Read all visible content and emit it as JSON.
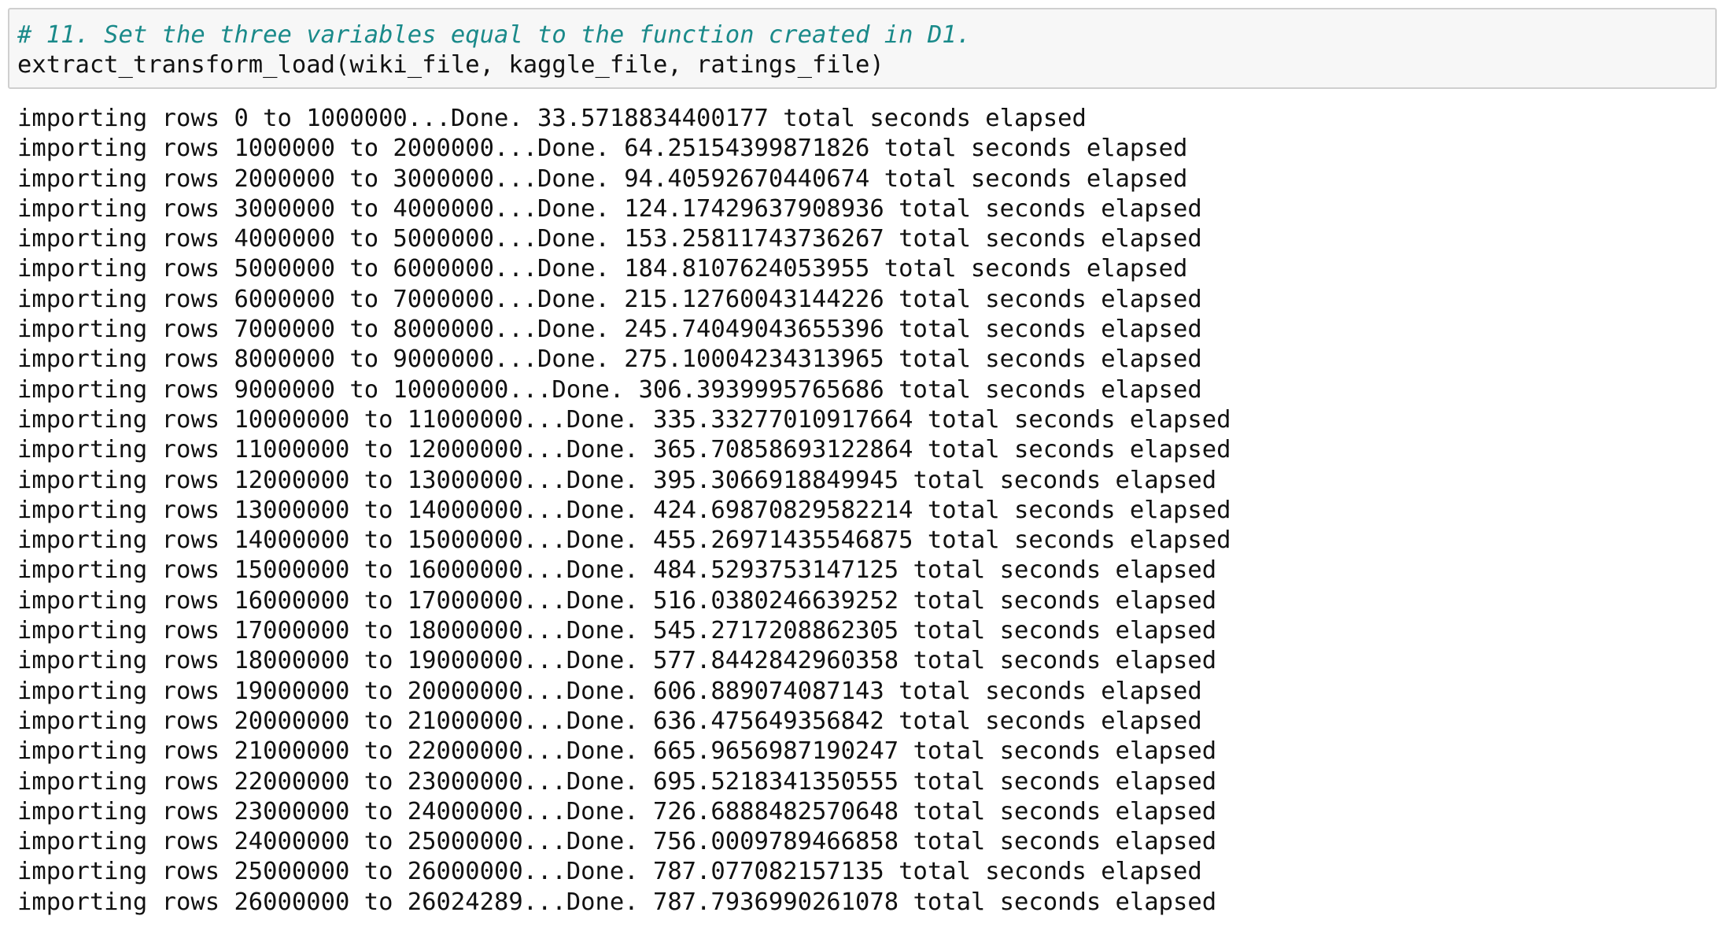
{
  "colors": {
    "comment": "#1a8a8a",
    "code": "#111111",
    "input_background": "#f7f7f7",
    "input_border": "#cfcfcf"
  },
  "input_cell": {
    "comment": "# 11. Set the three variables equal to the function created in D1.",
    "code": "extract_transform_load(wiki_file, kaggle_file, ratings_file)"
  },
  "output_lines": [
    "importing rows 0 to 1000000...Done. 33.5718834400177 total seconds elapsed",
    "importing rows 1000000 to 2000000...Done. 64.25154399871826 total seconds elapsed",
    "importing rows 2000000 to 3000000...Done. 94.40592670440674 total seconds elapsed",
    "importing rows 3000000 to 4000000...Done. 124.17429637908936 total seconds elapsed",
    "importing rows 4000000 to 5000000...Done. 153.25811743736267 total seconds elapsed",
    "importing rows 5000000 to 6000000...Done. 184.8107624053955 total seconds elapsed",
    "importing rows 6000000 to 7000000...Done. 215.12760043144226 total seconds elapsed",
    "importing rows 7000000 to 8000000...Done. 245.74049043655396 total seconds elapsed",
    "importing rows 8000000 to 9000000...Done. 275.10004234313965 total seconds elapsed",
    "importing rows 9000000 to 10000000...Done. 306.3939995765686 total seconds elapsed",
    "importing rows 10000000 to 11000000...Done. 335.33277010917664 total seconds elapsed",
    "importing rows 11000000 to 12000000...Done. 365.70858693122864 total seconds elapsed",
    "importing rows 12000000 to 13000000...Done. 395.3066918849945 total seconds elapsed",
    "importing rows 13000000 to 14000000...Done. 424.69870829582214 total seconds elapsed",
    "importing rows 14000000 to 15000000...Done. 455.26971435546875 total seconds elapsed",
    "importing rows 15000000 to 16000000...Done. 484.5293753147125 total seconds elapsed",
    "importing rows 16000000 to 17000000...Done. 516.0380246639252 total seconds elapsed",
    "importing rows 17000000 to 18000000...Done. 545.2717208862305 total seconds elapsed",
    "importing rows 18000000 to 19000000...Done. 577.8442842960358 total seconds elapsed",
    "importing rows 19000000 to 20000000...Done. 606.889074087143 total seconds elapsed",
    "importing rows 20000000 to 21000000...Done. 636.475649356842 total seconds elapsed",
    "importing rows 21000000 to 22000000...Done. 665.9656987190247 total seconds elapsed",
    "importing rows 22000000 to 23000000...Done. 695.5218341350555 total seconds elapsed",
    "importing rows 23000000 to 24000000...Done. 726.6888482570648 total seconds elapsed",
    "importing rows 24000000 to 25000000...Done. 756.0009789466858 total seconds elapsed",
    "importing rows 25000000 to 26000000...Done. 787.077082157135 total seconds elapsed",
    "importing rows 26000000 to 26024289...Done. 787.7936990261078 total seconds elapsed"
  ]
}
